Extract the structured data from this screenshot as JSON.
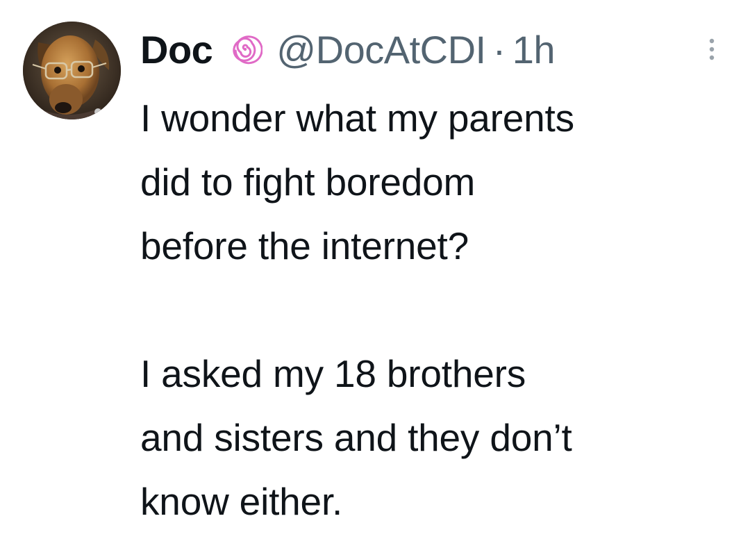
{
  "tweet": {
    "author": {
      "display_name": "Doc",
      "handle": "@DocAtCDI",
      "avatar_icon": "dog-with-glasses-avatar",
      "badge_icon": "pink-spiral-icon",
      "badge_color": "#e06ac6"
    },
    "separator": "·",
    "timestamp": "1h",
    "more_icon": "more-vertical-icon",
    "paragraphs": [
      {
        "lines": [
          "I wonder what my parents",
          "did to fight boredom",
          "before the internet?"
        ]
      },
      {
        "lines": [
          "I asked my 18 brothers",
          "and sisters and they don’t",
          "know either."
        ]
      }
    ]
  },
  "colors": {
    "text_primary": "#0f1419",
    "text_secondary": "#536471",
    "background": "#ffffff"
  }
}
